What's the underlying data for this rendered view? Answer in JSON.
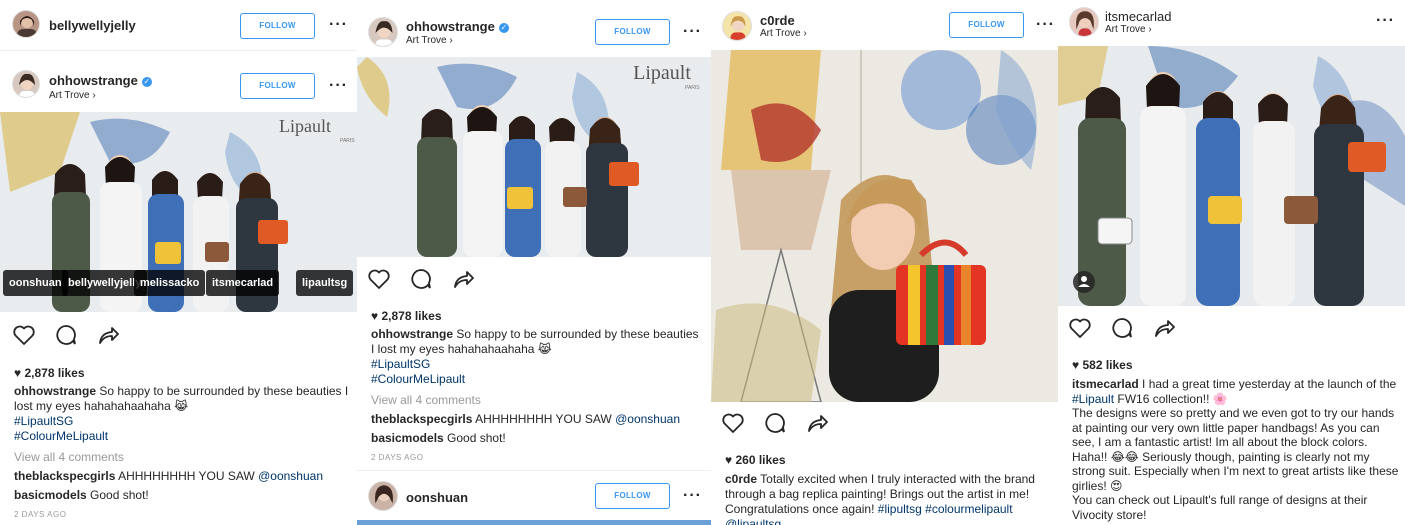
{
  "posts": [
    {
      "top_user": "bellywellyjelly",
      "top_follow": "FOLLOW",
      "user": "ohhowstrange",
      "location": "Art Trove",
      "follow": "FOLLOW",
      "tags": [
        "oonshuan",
        "bellywellyjelly",
        "melissacko",
        "itsmecarlad",
        "lipaultsg"
      ],
      "likes": "2,878 likes",
      "caption_user": "ohhowstrange",
      "caption": "So happy to be surrounded by these beauties I lost my eyes hahahahaahaha 😹",
      "hashtags": [
        "#LipaultSG",
        "#ColourMeLipault"
      ],
      "view_all": "View all 4 comments",
      "comments": [
        {
          "user": "theblackspecgirls",
          "text": "AHHHHHHHH YOU SAW",
          "mention": "@oonshuan"
        },
        {
          "user": "basicmodels",
          "text": "Good shot!"
        }
      ],
      "time": "2 DAYS AGO"
    },
    {
      "user": "ohhowstrange",
      "location": "Art Trove",
      "follow": "FOLLOW",
      "likes": "2,878 likes",
      "caption_user": "ohhowstrange",
      "caption": "So happy to be surrounded by these beauties I lost my eyes hahahahaahaha 😹",
      "hashtags": [
        "#LipaultSG",
        "#ColourMeLipault"
      ],
      "view_all": "View all 4 comments",
      "comments": [
        {
          "user": "theblackspecgirls",
          "text": "AHHHHHHHH YOU SAW",
          "mention": "@oonshuan"
        },
        {
          "user": "basicmodels",
          "text": "Good shot!"
        }
      ],
      "time": "2 DAYS AGO",
      "next_user": "oonshuan",
      "next_follow": "FOLLOW"
    },
    {
      "user": "c0rde",
      "location": "Art Trove",
      "follow": "FOLLOW",
      "likes": "260 likes",
      "caption_user": "c0rde",
      "caption": "Totally excited when I truly interacted with the brand through a bag replica painting! Brings out the artist in me! Congratulations once again!",
      "hashtags": [
        "#lipultsg",
        "#colourmelipault",
        "@lipaultsg"
      ]
    },
    {
      "user": "itsmecarlad",
      "location": "Art Trove",
      "likes": "582 likes",
      "caption_user": "itsmecarlad",
      "caption_1": "I had a great time yesterday at the launch of the",
      "hashtag_1": "#Lipault",
      "caption_2": "FW16 collection!! 🌸",
      "caption_3": "The designs were so pretty and we even got to try our hands at painting our very own little paper handbags! As you can see, I am a fantastic artist! Im all about the block colors. Haha!! 😂😂 Seriously though, painting is clearly not my strong suit. Especially when I'm next to great artists like these girlies! 😍",
      "caption_4": "You can check out Lipault's full range of designs at their Vivocity store!"
    }
  ],
  "icons": [
    "heart-icon",
    "comment-icon",
    "share-icon",
    "more-icon",
    "verified-badge-icon",
    "chevron-right-icon",
    "user-tag-icon"
  ],
  "accent": "#3897f0",
  "hashtag_color": "#003569",
  "brand_text": "Lipault",
  "brand_sub": "PARIS"
}
